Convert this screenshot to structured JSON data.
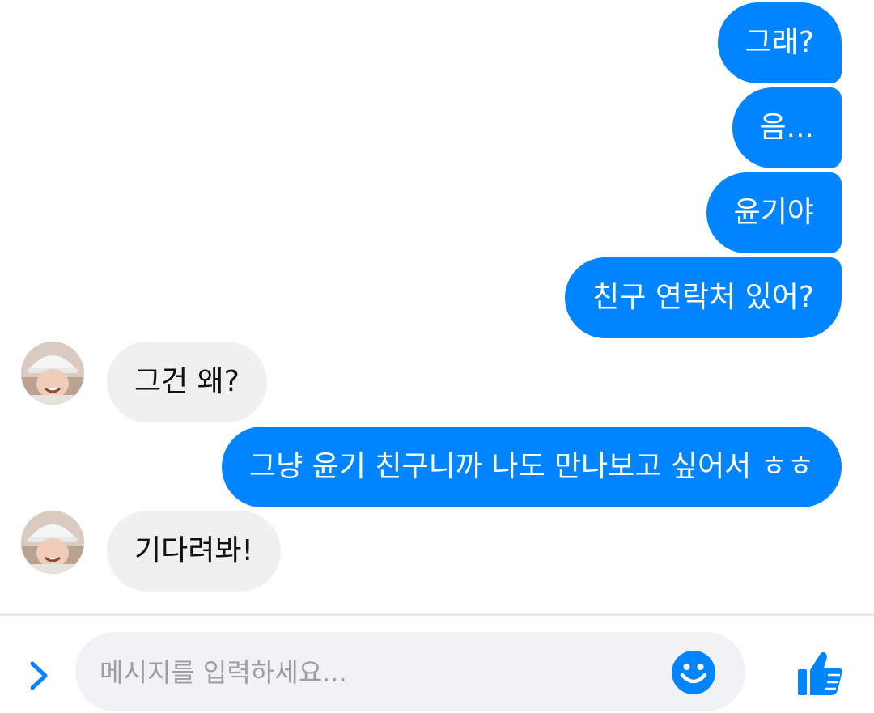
{
  "messages": [
    {
      "side": "out",
      "text": "그래?"
    },
    {
      "side": "out",
      "text": "음..."
    },
    {
      "side": "out",
      "text": "윤기야"
    },
    {
      "side": "out",
      "text": "친구 연락처 있어?"
    },
    {
      "side": "in",
      "text": "그건 왜?"
    },
    {
      "side": "out",
      "text": "그냥 윤기 친구니까 나도 만나보고 싶어서 ㅎㅎ"
    },
    {
      "side": "in",
      "text": "기다려봐!"
    }
  ],
  "composer": {
    "placeholder": "메시지를 입력하세요...",
    "expand_icon": "chevron-right-icon",
    "emoji_icon": "smiley-icon",
    "like_icon": "thumbs-up-icon"
  },
  "colors": {
    "accent": "#0084ff",
    "incoming_bubble": "#f1f0f0",
    "input_bg": "#f1f2f4",
    "divider": "#e9eaed"
  }
}
